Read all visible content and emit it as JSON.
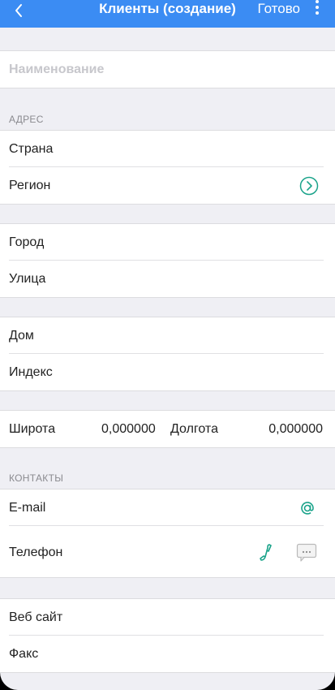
{
  "header": {
    "title": "Клиенты (создание)",
    "done_label": "Готово",
    "back_icon": "chevron-left-icon",
    "menu_icon": "more-vertical-icon",
    "color": "#3b8cf3"
  },
  "name_field": {
    "placeholder": "Наименование"
  },
  "address": {
    "heading": "АДРЕС",
    "country_label": "Страна",
    "region_label": "Регион",
    "city_label": "Город",
    "street_label": "Улица",
    "house_label": "Дом",
    "index_label": "Индекс"
  },
  "coords": {
    "latitude_label": "Широта",
    "latitude_value": "0,000000",
    "longitude_label": "Долгота",
    "longitude_value": "0,000000"
  },
  "contacts": {
    "heading": "КОНТАКТЫ",
    "email_label": "E-mail",
    "phone_label": "Телефон",
    "website_label": "Веб сайт",
    "fax_label": "Факс",
    "accent_color": "#1aa38a"
  }
}
